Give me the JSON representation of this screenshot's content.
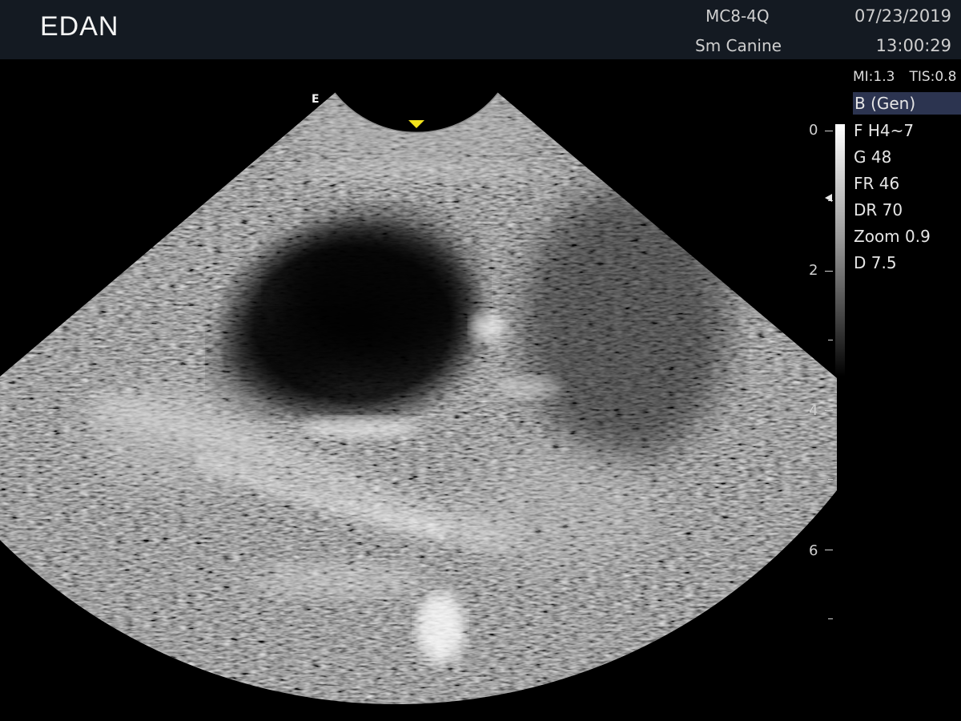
{
  "header": {
    "logo": "EDAN",
    "probe": "MC8-4Q",
    "preset": "Sm Canine",
    "date": "07/23/2019",
    "time": "13:00:29"
  },
  "indices": {
    "mi": "MI:1.3",
    "tis": "TIS:0.8"
  },
  "mode": "B (Gen)",
  "params": [
    "F H4~7",
    "G 48",
    "FR 46",
    "DR 70",
    "Zoom 0.9",
    "D 7.5"
  ],
  "depth_scale": {
    "labels": [
      "0",
      "2",
      "4",
      "6"
    ]
  },
  "orientation_mark": "E",
  "colors": {
    "header_bg": "#141a22",
    "mode_highlight": "#2c3450",
    "focus_triangle": "#f3e31c"
  }
}
